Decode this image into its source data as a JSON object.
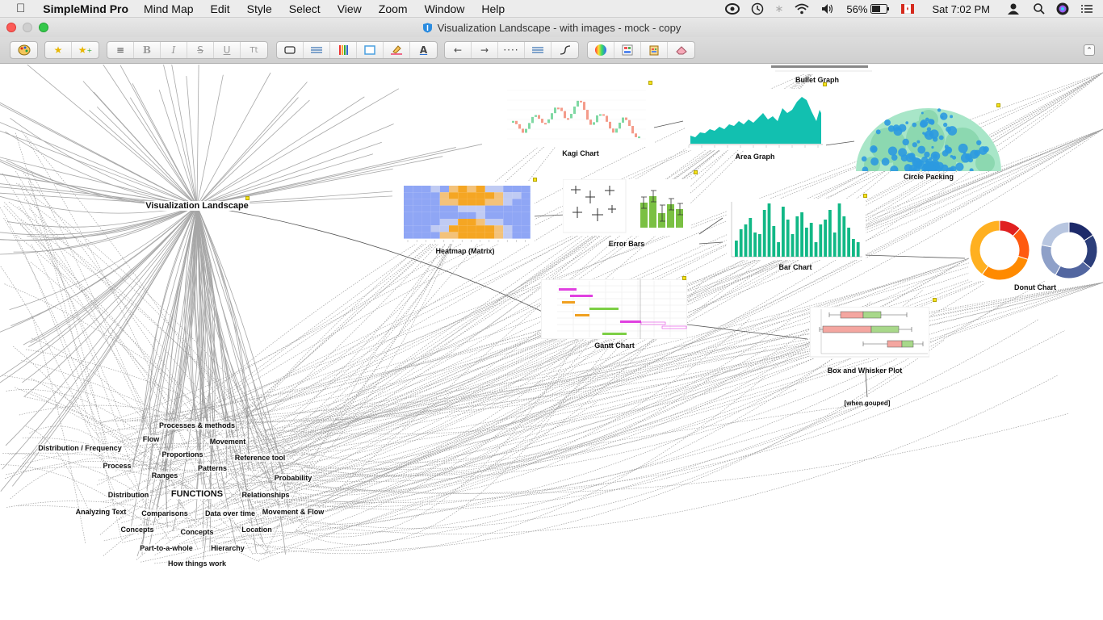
{
  "menubar": {
    "app_name": "SimpleMind Pro",
    "items": [
      "Mind Map",
      "Edit",
      "Style",
      "Select",
      "View",
      "Zoom",
      "Window",
      "Help"
    ],
    "battery": "56%",
    "clock": "Sat 7:02 PM"
  },
  "window": {
    "title": "Visualization Landscape - with images - mock - copy"
  },
  "mindmap": {
    "central": "Visualization Landscape",
    "functions": "FUNCTIONS",
    "function_nodes": [
      "Processes & methods",
      "Flow",
      "Movement",
      "Distribution / Frequency",
      "Proportions",
      "Reference tool",
      "Process",
      "Patterns",
      "Probability",
      "Ranges",
      "Distribution",
      "Relationships",
      "Analyzing Text",
      "Comparisons",
      "Data over time",
      "Movement & Flow",
      "Concepts",
      "Concepts",
      "Location",
      "Part-to-a-whole",
      "Hierarchy",
      "How things work"
    ],
    "charts": {
      "bullet": "Bullet Graph",
      "kagi": "Kagi Chart",
      "area": "Area Graph",
      "circle_packing": "Circle Packing",
      "heatmap": "Heatmap (Matrix)",
      "error_bars": "Error Bars",
      "bar": "Bar Chart",
      "donut": "Donut Chart",
      "gantt": "Gantt Chart",
      "box_whisker": "Box and Whisker Plot"
    },
    "box_note": "[when gouped]"
  },
  "colors": {
    "accent_teal": "#1bbf9f",
    "bar_green": "#12b886",
    "donut_orange": "#ff9f1a",
    "donut_navy": "#2c3e7a",
    "heat_blue": "#8fa6f5",
    "heat_orange": "#f5a623",
    "kagi_green": "#7fd8a3",
    "kagi_red": "#f49b8a",
    "gantt_magenta": "#e040e0",
    "gantt_green": "#7ccf45"
  }
}
